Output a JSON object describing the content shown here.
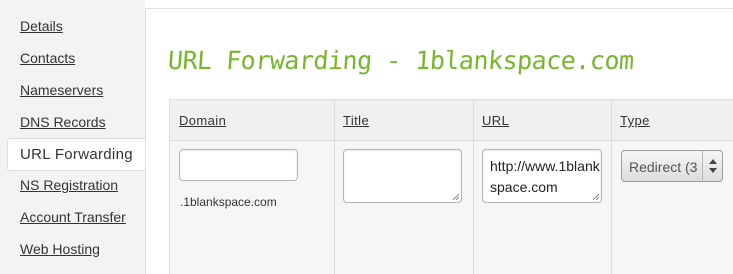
{
  "sidebar": {
    "items": [
      {
        "label": "Details"
      },
      {
        "label": "Contacts"
      },
      {
        "label": "Nameservers"
      },
      {
        "label": "DNS Records"
      },
      {
        "label": "URL Forwarding",
        "active": true
      },
      {
        "label": "NS Registration"
      },
      {
        "label": "Account Transfer"
      },
      {
        "label": "Web Hosting"
      }
    ]
  },
  "main": {
    "title": "URL Forwarding - 1blankspace.com",
    "table": {
      "headers": {
        "domain": "Domain",
        "title": "Title",
        "url": "URL",
        "type": "Type"
      },
      "row": {
        "domain_value": "",
        "domain_label": ".1blankspace.com",
        "title_value": "",
        "url_value": "http://www.1blankspace.com",
        "type_value": "Redirect (3"
      }
    }
  },
  "colors": {
    "accent_title": "#76b82a",
    "sidebar_bg": "#f3f3f3",
    "table_header_bg": "#f0f0f0"
  }
}
